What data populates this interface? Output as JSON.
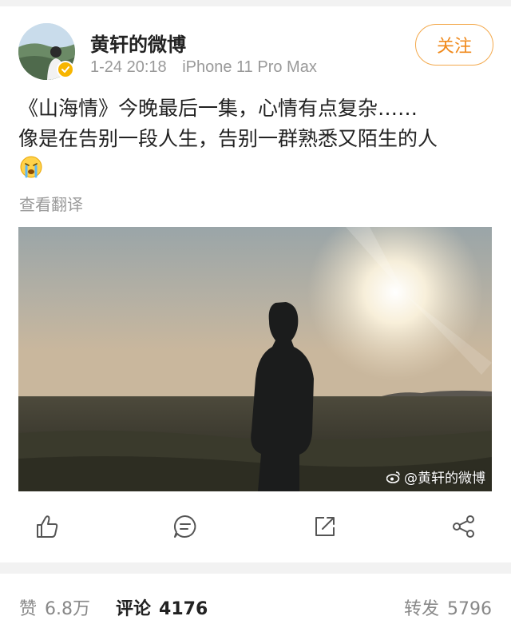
{
  "post": {
    "username": "黄轩的微博",
    "date": "1-24 20:18",
    "device": "iPhone 11 Pro Max",
    "follow_label": "关注",
    "text_lines": [
      "《山海情》今晚最后一集，心情有点复杂……",
      "像是在告别一段人生，告别一群熟悉又陌生的人"
    ],
    "emoji": "crying-face-icon",
    "translate_label": "查看翻译",
    "image_watermark": "@黄轩的微博"
  },
  "actions": [
    "thumbs-up-icon",
    "comment-icon",
    "repost-icon",
    "share-icon"
  ],
  "stats": {
    "like_label": "赞",
    "like_count": "6.8万",
    "comment_label": "评论",
    "comment_count": "4176",
    "repost_label": "转发",
    "repost_count": "5796"
  },
  "colors": {
    "accent": "#f08a1c",
    "follow_border": "#f3a94c",
    "verified": "#f7b500",
    "muted_text": "#999999",
    "icon_stroke": "#555555"
  }
}
